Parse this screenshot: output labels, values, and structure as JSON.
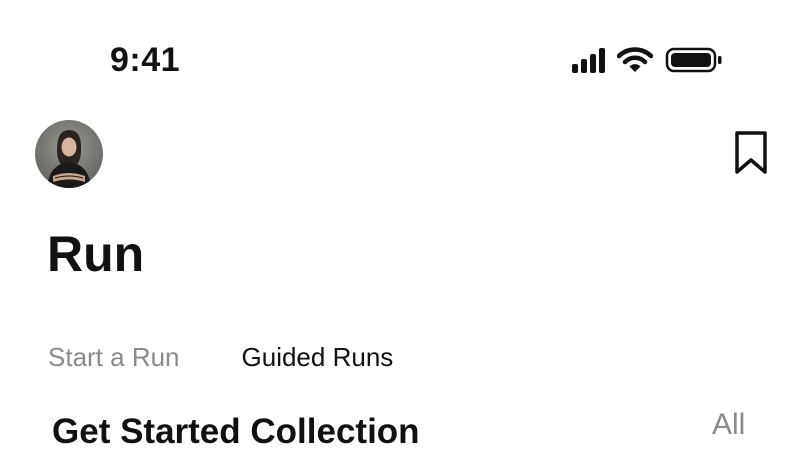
{
  "status_bar": {
    "time": "9:41"
  },
  "header": {
    "avatar_icon": "profile-photo",
    "bookmark_icon": "bookmark-icon"
  },
  "page": {
    "title": "Run"
  },
  "tabs": [
    {
      "label": "Start a Run",
      "active": false
    },
    {
      "label": "Guided Runs",
      "active": true
    }
  ],
  "section": {
    "title": "Get Started Collection",
    "link_label": "All"
  },
  "colors": {
    "text_primary": "#111111",
    "text_secondary": "#8a8a8a",
    "background": "#ffffff"
  }
}
